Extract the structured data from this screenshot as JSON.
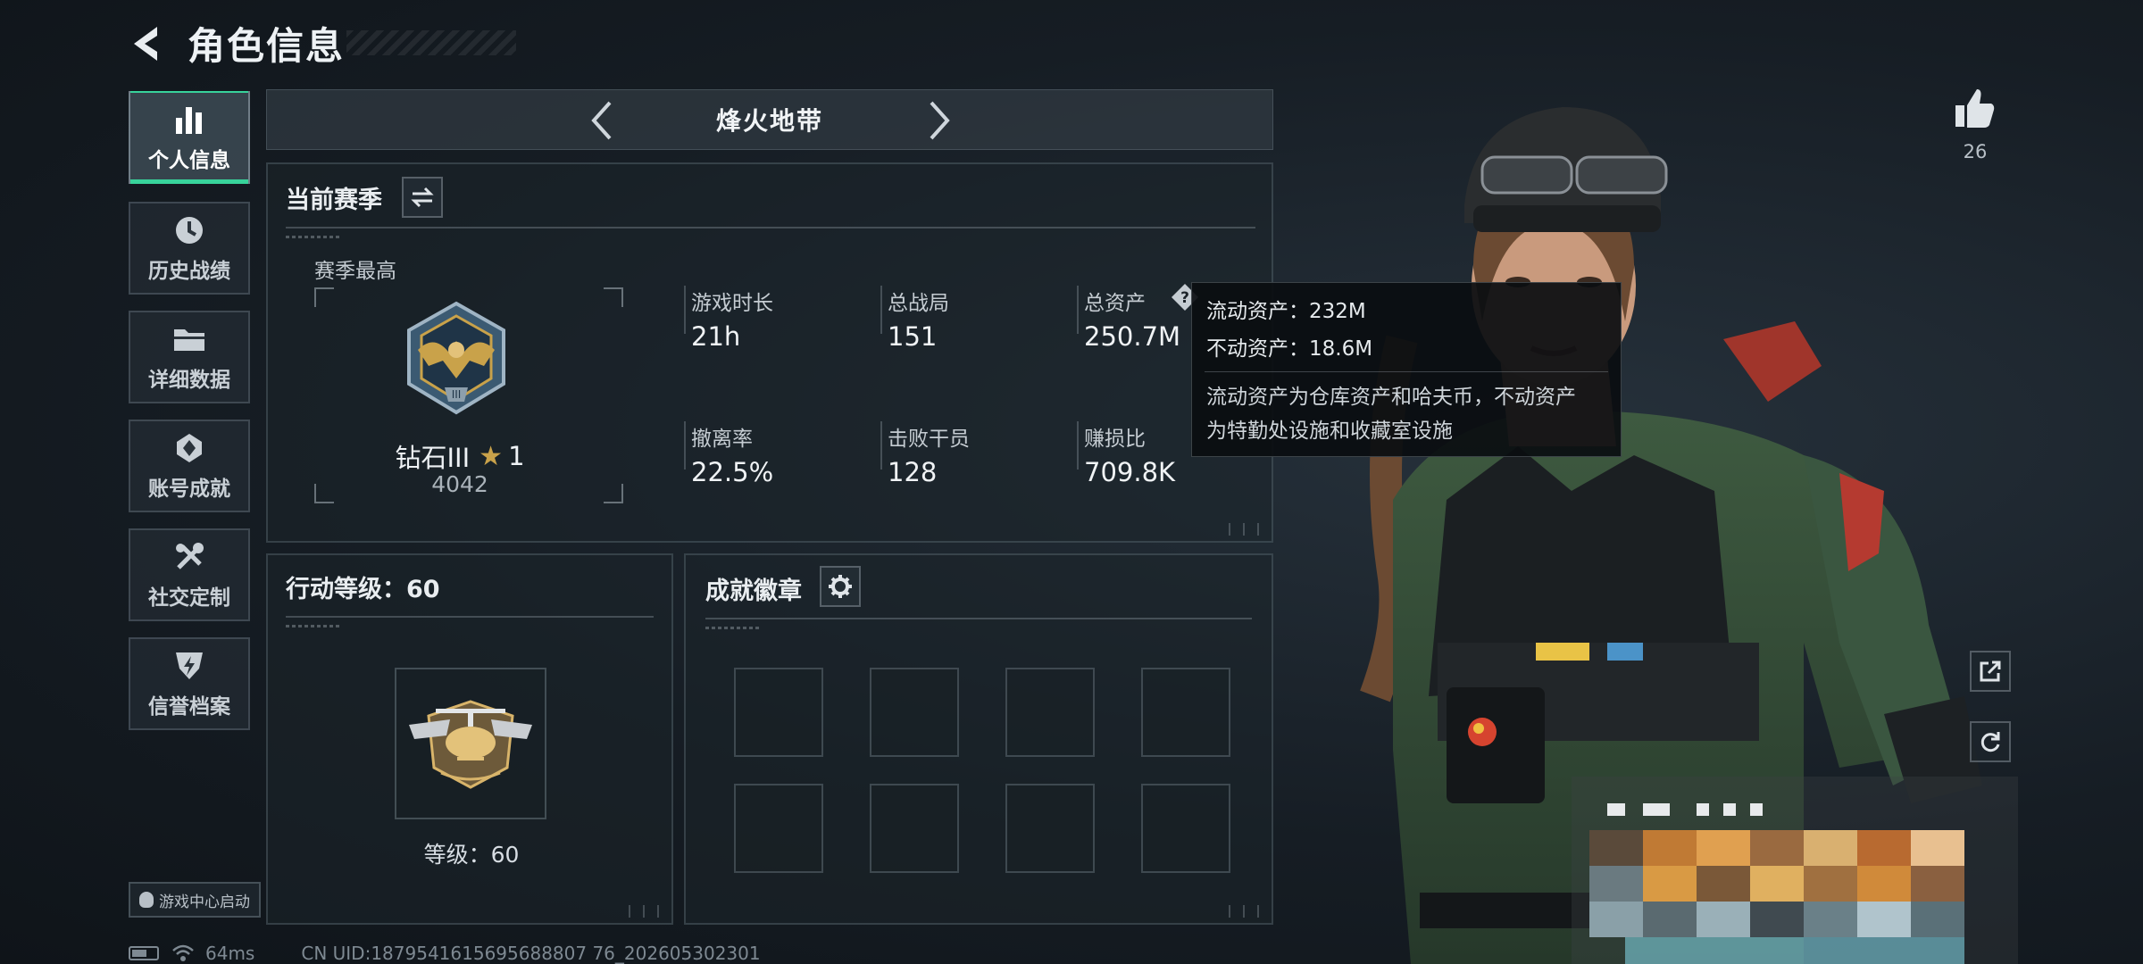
{
  "header": {
    "title": "角色信息"
  },
  "sidebar": {
    "items": [
      {
        "label": "个人信息",
        "icon": "bar-chart-icon",
        "active": true
      },
      {
        "label": "历史战绩",
        "icon": "history-clock-icon",
        "active": false
      },
      {
        "label": "详细数据",
        "icon": "folder-icon",
        "active": false
      },
      {
        "label": "账号成就",
        "icon": "achievement-icon",
        "active": false
      },
      {
        "label": "社交定制",
        "icon": "tools-icon",
        "active": false
      },
      {
        "label": "信誉档案",
        "icon": "shield-bolt-icon",
        "active": false
      }
    ],
    "launch_label": "游戏中心启动"
  },
  "mode_selector": {
    "title": "烽火地带"
  },
  "season_panel": {
    "title": "当前赛季",
    "best_label": "赛季最高",
    "rank_name": "钻石III",
    "rank_stars": "1",
    "rank_score": "4042",
    "stats": [
      {
        "label": "游戏时长",
        "value": "21h"
      },
      {
        "label": "总战局",
        "value": "151"
      },
      {
        "label": "总资产",
        "value": "250.7M"
      },
      {
        "label": "撤离率",
        "value": "22.5%"
      },
      {
        "label": "击败干员",
        "value": "128"
      },
      {
        "label": "赚损比",
        "value": "709.8K"
      }
    ]
  },
  "tooltip": {
    "liquid": "流动资产：232M",
    "fixed": "不动资产：18.6M",
    "desc_line1": "流动资产为仓库资产和哈夫币，不动资产",
    "desc_line2": "为特勤处设施和收藏室设施"
  },
  "level_panel": {
    "title": "行动等级：60",
    "level_label": "等级：60"
  },
  "badge_panel": {
    "title": "成就徽章",
    "slots": 8
  },
  "likes": {
    "count": "26"
  },
  "status_bar": {
    "ping": "64ms",
    "uid": "CN UID:1879541615695688807 76_202605302301"
  },
  "colors": {
    "accent": "#38d39b",
    "rank_gold": "#c9a24a",
    "background": "#161d24"
  }
}
